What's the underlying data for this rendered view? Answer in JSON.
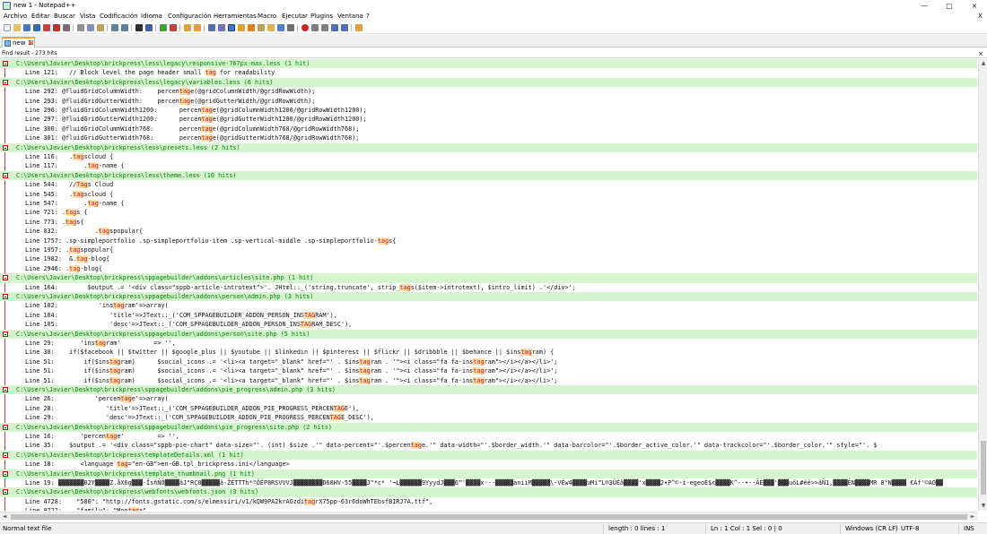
{
  "window": {
    "title": "new 1 - Notepad++",
    "min": "—",
    "max": "□",
    "close": "×"
  },
  "menu": [
    "Archivo",
    "Editar",
    "Buscar",
    "Vista",
    "Codificación",
    "Idioma",
    "Configuración",
    "Herramientas",
    "Macro",
    "Ejecutar",
    "Plugins",
    "Ventana",
    "?"
  ],
  "menu_close": "X",
  "tab": {
    "label": "new 1",
    "close": "⊠"
  },
  "find": {
    "header": "Find result - 273 hits",
    "close": "×"
  },
  "results": [
    {
      "t": "f",
      "text": "C:\\Users\\Javier\\Desktop\\brickpress\\less\\legacy\\responsive-767px-max.less (1 hit)"
    },
    {
      "t": "l",
      "text": "Line 121:   // Block level the page header small tag for readability"
    },
    {
      "t": "f",
      "text": "C:\\Users\\Javier\\Desktop\\brickpress\\less\\legacy\\variables.less (6 hits)"
    },
    {
      "t": "l",
      "text": "Line 292: @fluidGridColumnWidth:    percentage(@gridColumnWidth/@gridRowWidth);"
    },
    {
      "t": "l",
      "text": "Line 293: @fluidGridGutterWidth:    percentage(@gridGutterWidth/@gridRowWidth);"
    },
    {
      "t": "l",
      "text": "Line 296: @fluidGridColumnWidth1200:      percentage(@gridColumnWidth1200/@gridRowWidth1200);"
    },
    {
      "t": "l",
      "text": "Line 297: @fluidGridGutterWidth1200:      percentage(@gridGutterWidth1200/@gridRowWidth1200);"
    },
    {
      "t": "l",
      "text": "Line 300: @fluidGridColumnWidth768:       percentage(@gridColumnWidth768/@gridRowWidth768);"
    },
    {
      "t": "l",
      "text": "Line 301: @fluidGridGutterWidth768:       percentage(@gridGutterWidth768/@gridRowWidth768);"
    },
    {
      "t": "f",
      "text": "C:\\Users\\Javier\\Desktop\\brickpress\\less\\presets.less (2 hits)"
    },
    {
      "t": "l",
      "text": "Line 116:   .tagscloud {"
    },
    {
      "t": "l",
      "text": "Line 117:       .tag-name {"
    },
    {
      "t": "f",
      "text": "C:\\Users\\Javier\\Desktop\\brickpress\\less\\theme.less (10 hits)"
    },
    {
      "t": "l",
      "text": "Line 544:   //Tags Cloud"
    },
    {
      "t": "l",
      "text": "Line 545:   .tagscloud {"
    },
    {
      "t": "l",
      "text": "Line 547:       .tag-name {"
    },
    {
      "t": "l",
      "text": "Line 721: .tags {"
    },
    {
      "t": "l",
      "text": "Line 773: .tags{"
    },
    {
      "t": "l",
      "text": "Line 832:          .tagspopular{"
    },
    {
      "t": "l",
      "text": "Line 1757: .sp-simpleportfolio .sp-simpleportfolio-item .sp-vertical-middle .sp-simpleportfolio-tags{"
    },
    {
      "t": "l",
      "text": "Line 1957: .tagspopular{"
    },
    {
      "t": "l",
      "text": "Line 1982:  &.tag-blog{"
    },
    {
      "t": "l",
      "text": "Line 2946: .tag-blog{"
    },
    {
      "t": "f",
      "text": "C:\\Users\\Javier\\Desktop\\brickpress\\sppagebuilder\\addons\\articles\\site.php (1 hit)"
    },
    {
      "t": "l",
      "text": "Line 164:        $output .= '<div class=\"sppb-article-introtext\">'. JHtml::_('string.truncate', strip_tags($item->introtext), $intro_limit) .'</div>';"
    },
    {
      "t": "f",
      "text": "C:\\Users\\Javier\\Desktop\\brickpress\\sppagebuilder\\addons\\person\\admin.php (3 hits)"
    },
    {
      "t": "l",
      "text": "Line 102:           'instagram'=>array("
    },
    {
      "t": "l",
      "text": "Line 104:              'title'=>JText::_('COM_SPPAGEBUILDER_ADDON_PERSON_INSTAGRAM'),"
    },
    {
      "t": "l",
      "text": "Line 105:              'desc'=>JText::_('COM_SPPAGEBUILDER_ADDON_PERSON_INSTAGRAM_DESC'),"
    },
    {
      "t": "f",
      "text": "C:\\Users\\Javier\\Desktop\\brickpress\\sppagebuilder\\addons\\person\\site.php (5 hits)"
    },
    {
      "t": "l",
      "text": "Line 29:       'instagram'         => '',"
    },
    {
      "t": "l",
      "text": "Line 38:    if($facebook || $twitter || $google_plus || $youtube || $linkedin || $pinterest || $flickr || $dribbble || $behance || $instagram) {"
    },
    {
      "t": "l",
      "text": "Line 51:        if($instagram)      $social_icons .= '<li><a target=\"_blank\" href=\"' . $instagram . '\"><i class=\"fa fa-instagram\"></i></a></li>';"
    },
    {
      "t": "l",
      "text": "Line 51:        if($instagram)      $social_icons .= '<li><a target=\"_blank\" href=\"' . $instagram . '\"><i class=\"fa fa-instagram\"></i></a></li>';"
    },
    {
      "t": "l",
      "text": "Line 51:        if($instagram)      $social_icons .= '<li><a target=\"_blank\" href=\"' . $instagram . '\"><i class=\"fa fa-instagram\"></i></a></li>';"
    },
    {
      "t": "f",
      "text": "C:\\Users\\Javier\\Desktop\\brickpress\\sppagebuilder\\addons\\pie_progress\\admin.php (3 hits)"
    },
    {
      "t": "l",
      "text": "Line 26:           'percentage'=>array("
    },
    {
      "t": "l",
      "text": "Line 28:              'title'=>JText::_('COM_SPPAGEBUILDER_ADDON_PIE_PROGRESS_PERCENTAGE'),"
    },
    {
      "t": "l",
      "text": "Line 29:              'desc'=>JText::_('COM_SPPAGEBUILDER_ADDON_PIE_PROGRESS_PERCENTAGE_DESC'),"
    },
    {
      "t": "f",
      "text": "C:\\Users\\Javier\\Desktop\\brickpress\\sppagebuilder\\addons\\pie_progress\\site.php (2 hits)"
    },
    {
      "t": "l",
      "text": "Line 16:       'percentage'         => '',"
    },
    {
      "t": "l",
      "text": "Line 35:    $output .= '<div class=\"sppb-pie-chart\" data-size=\"'. (int) $size .'\" data-percent=\"'.$percentage.'\" data-width=\"'.$border_width.'\" data-barcolor=\"'.$border_active_color.'\" data-trackcolor=\"'.$border_color.'\" style=\"'. $"
    },
    {
      "t": "f",
      "text": "C:\\Users\\Javier\\Desktop\\brickpress\\templateDetails.xml (1 hit)"
    },
    {
      "t": "l",
      "text": "Line 18:       <language tag=\"en-GB\">en-GB.tpl_brickpress.ini</language>"
    },
    {
      "t": "f",
      "text": "C:\\Users\\Javier\\Desktop\\brickpress\\template_thumbnail.png (1 hit)"
    },
    {
      "t": "l",
      "text": "Line 19: ▓▓▓▓▓▓▓02Y▓▓▓▓Z.åX6g▓▓▓-ÎsñÑÔ▓▓▓▓âJ\"RÇ8▓▓▓▓▓â-ŽÉTTTh*ºÔÉP8RSVVVJ▓▓▓▓▓▓▓▓D68HV-55▓▓▓▓J\"*c* '¬L▓▓▓▓▓▓9YyydJ▓▓▓6™'▓▓▓▓x---▓▓▓▓▓aniiM▓▓▓▓▓\\-VËw4▓▓▓▓uMi™L®3ÛÈâ▓▓▓▓'x▓▓▓▓2•P^©-i-egeoÈ$c▓▓▓▓K^--•··ÂÈ▓▓▓'▓▓▓uôL#ëë>>ãÑ1,▓▓▓▓ÈN▓▓▓▓MR 8°N▓▓▓▓ €Áf'©AO▓▓"
    },
    {
      "t": "f",
      "text": "C:\\Users\\Javier\\Desktop\\brickpress\\webfonts\\webfonts.json (3 hits)"
    },
    {
      "t": "l",
      "text": "Line 4728:    \"500\": \"http://fonts.gstatic.com/s/elmessiri/v1/kQW9PA2krAOzditagrX75pp-63r6doWhTEbsfBIRJ7A.ttf\","
    },
    {
      "t": "l",
      "text": "Line 9722:    \"family\": \"Montaga\","
    }
  ],
  "status": {
    "doc_type": "Normal text file",
    "length": "length : 0   lines : 1",
    "pos": "Ln : 1   Col : 1   Sel : 0 | 0",
    "eol": "Windows (CR LF)",
    "enc": "UTF-8",
    "mode": "INS"
  },
  "colors": {
    "file_bg": "#d5f5cf",
    "file_text": "#008000",
    "hit_bg": "#fbe0a6",
    "hit_text": "#d0101a"
  }
}
